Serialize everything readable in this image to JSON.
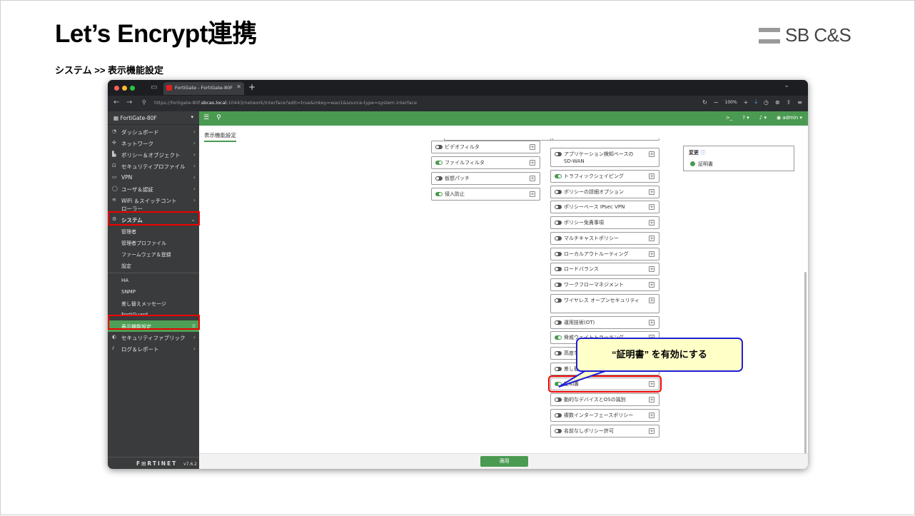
{
  "slide": {
    "title": "Let’s Encrypt連携",
    "subtitle": "システム >> 表示機能設定",
    "logo": "SB C&S"
  },
  "browser": {
    "tab_title": "FortiGate - FortiGate-80F",
    "url_prefix": "https://fortigate-80f.",
    "url_host": "sbcas.local",
    "url_rest": ":10443/network/interface?edit=true&mkey=wan1&source-type=system.interface",
    "zoom": "100%"
  },
  "sidebar": {
    "device": "FortiGate-80F",
    "items": [
      {
        "label": "ダッシュボード",
        "icon": "dashboard-icon"
      },
      {
        "label": "ネットワーク",
        "icon": "network-icon"
      },
      {
        "label": "ポリシー＆オブジェクト",
        "icon": "policy-icon"
      },
      {
        "label": "セキュリティプロファイル",
        "icon": "lock-icon"
      },
      {
        "label": "VPN",
        "icon": "vpn-icon"
      },
      {
        "label": "ユーザ＆認証",
        "icon": "user-icon"
      },
      {
        "label": "WiFi ＆スイッチコント",
        "label2": "ローラー",
        "icon": "wifi-icon"
      },
      {
        "label": "システム",
        "icon": "gear-icon"
      }
    ],
    "system_sub1": [
      "管理者",
      "管理者プロファイル",
      "ファームウェア＆登録",
      "設定"
    ],
    "system_sub2": [
      "HA",
      "SNMP",
      "差し替えメッセージ",
      "FortiGuard"
    ],
    "active": "表示機能設定",
    "items_after": [
      {
        "label": "セキュリティファブリック",
        "icon": "fabric-icon"
      },
      {
        "label": "ログ＆レポート",
        "icon": "log-icon"
      }
    ],
    "brand": "F⊞RTINET",
    "version": "v7.6.2"
  },
  "topnav": {
    "user": "admin"
  },
  "content": {
    "page_title": "表示機能設定",
    "left_col": [
      {
        "label": "ビデオフィルタ",
        "on": false
      },
      {
        "label": "ファイルフィルタ",
        "on": true
      },
      {
        "label": "仮想パッチ",
        "on": false
      },
      {
        "label": "侵入防止",
        "on": true
      }
    ],
    "right_col": [
      {
        "label": "アプリケーション検知ベースの SD-WAN",
        "on": false
      },
      {
        "label": "トラフィックシェイピング",
        "on": true
      },
      {
        "label": "ポリシーの詳細オプション",
        "on": false
      },
      {
        "label": "ポリシーベース IPsec VPN",
        "on": false
      },
      {
        "label": "ポリシー免責事項",
        "on": false
      },
      {
        "label": "マルチキャストポリシー",
        "on": false
      },
      {
        "label": "ローカルアウトルーティング",
        "on": false
      },
      {
        "label": "ロードバランス",
        "on": false
      },
      {
        "label": "ワークフローマネジメント",
        "on": false
      },
      {
        "label": "ワイヤレス オープンセキュリティ",
        "on": false
      },
      {
        "label": "運用技術(OT)",
        "on": false
      },
      {
        "label": "脅威ウェイトトラッキング",
        "on": true
      },
      {
        "label": "高度なワイヤレス機能",
        "on": false
      },
      {
        "label": "差し替えメッセージグループ",
        "on": false
      },
      {
        "label": "証明書",
        "on": true
      },
      {
        "label": "動的なデバイスとOSの識別",
        "on": false
      },
      {
        "label": "複数インターフェースポリシー",
        "on": false
      },
      {
        "label": "名前なしポリシー許可",
        "on": false
      }
    ],
    "changes_title": "変更",
    "changes_item": "証明書",
    "apply": "適用"
  },
  "callout": "“証明書” を有効にする"
}
